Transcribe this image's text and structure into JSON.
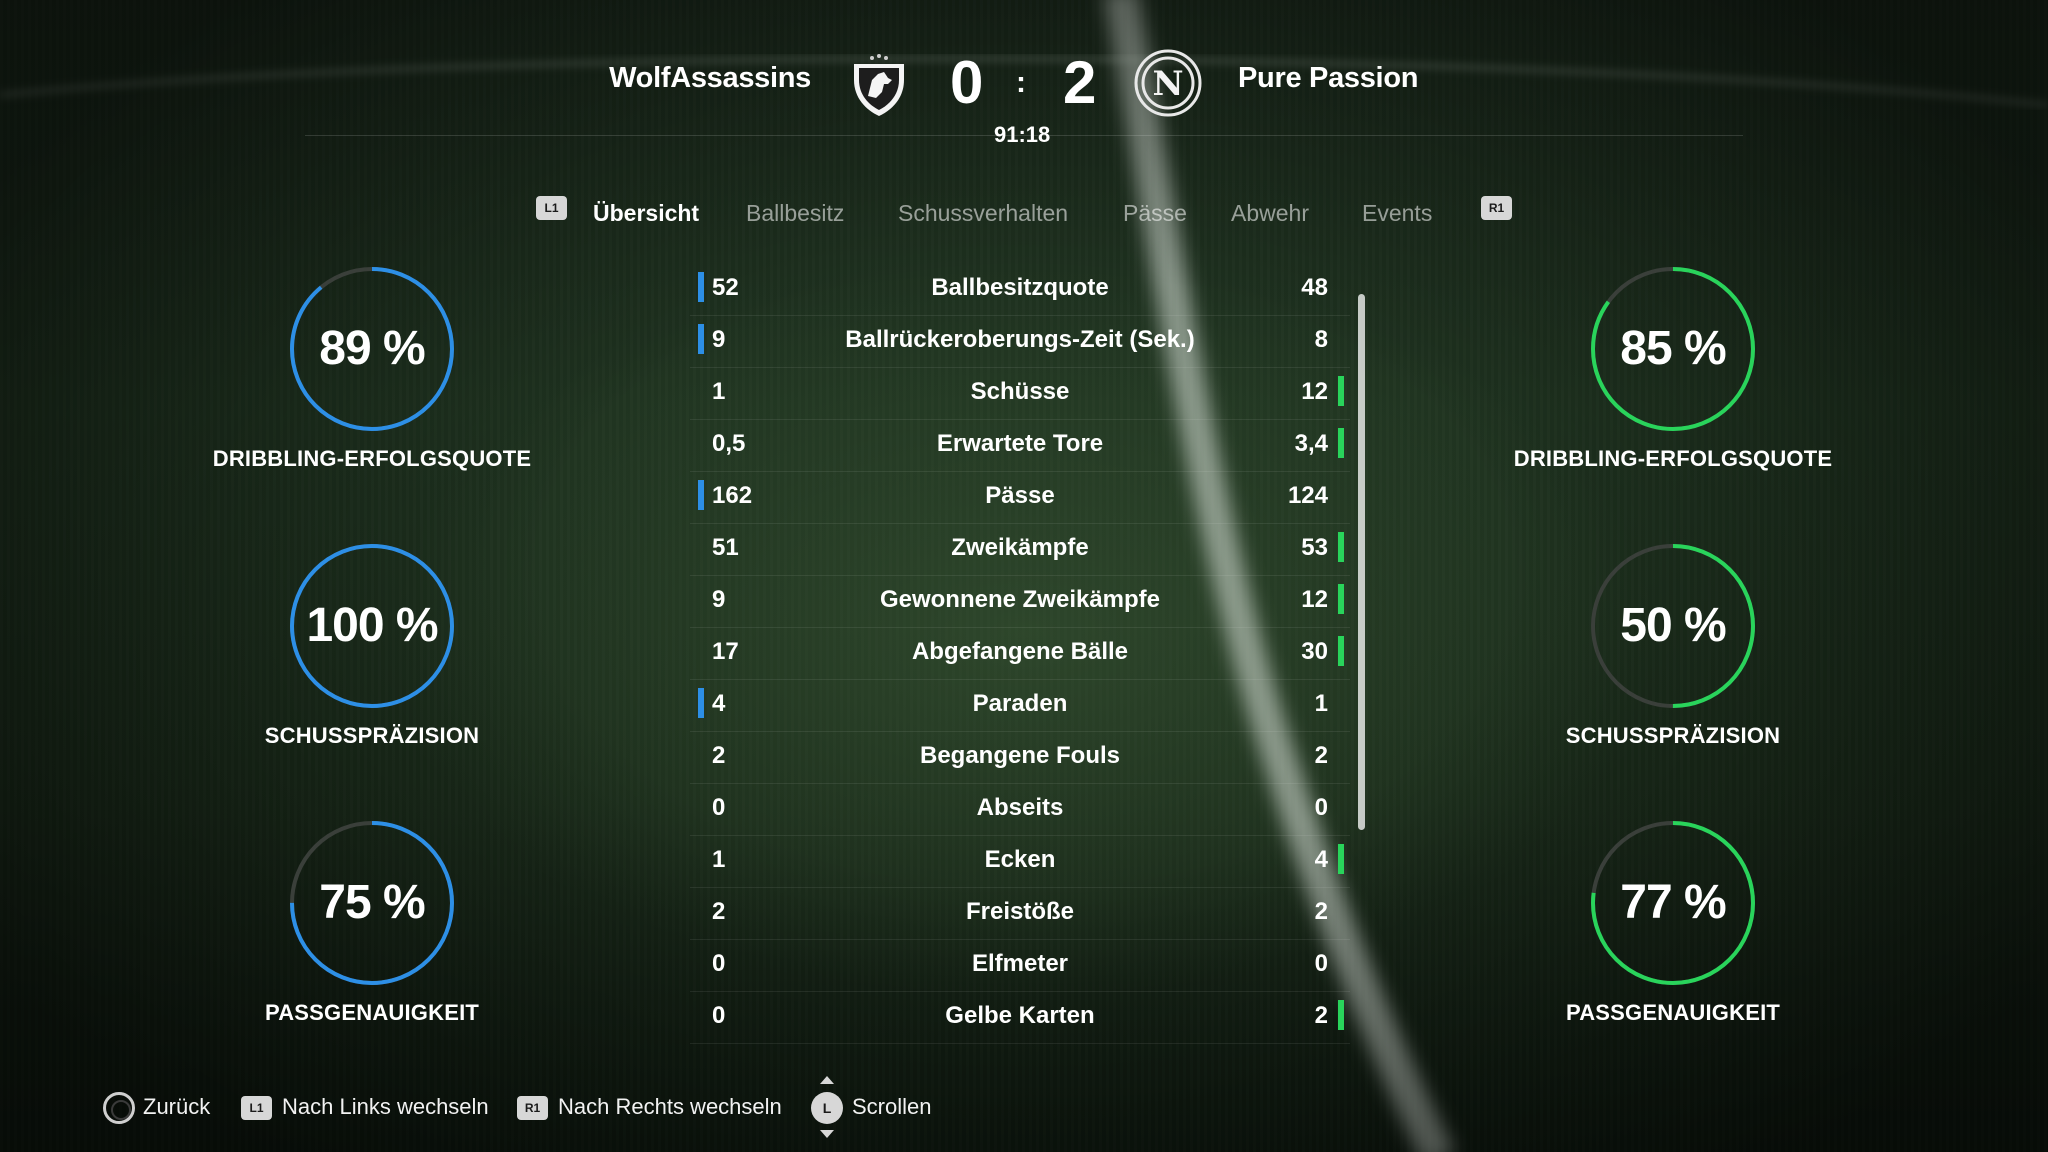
{
  "match": {
    "home_team": "WolfAssassins",
    "away_team": "Pure Passion",
    "home_score": "0",
    "away_score": "2",
    "separator": ":",
    "time": "91:18",
    "away_crest_letter": "N",
    "home_crest_icon": "wolf-shield-icon",
    "away_crest_icon": "napoli-crest-icon"
  },
  "tabs": {
    "prev_button": "L1",
    "next_button": "R1",
    "items": [
      {
        "label": "Übersicht",
        "active": true
      },
      {
        "label": "Ballbesitz",
        "active": false
      },
      {
        "label": "Schussverhalten",
        "active": false
      },
      {
        "label": "Pässe",
        "active": false
      },
      {
        "label": "Abwehr",
        "active": false
      },
      {
        "label": "Events",
        "active": false
      }
    ]
  },
  "home_gauges": [
    {
      "value": "89 %",
      "percent": 89,
      "label": "DRIBBLING-ERFOLGSQUOTE"
    },
    {
      "value": "100 %",
      "percent": 100,
      "label": "SCHUSSPRÄZISION"
    },
    {
      "value": "75 %",
      "percent": 75,
      "label": "PASSGENAUIGKEIT"
    }
  ],
  "away_gauges": [
    {
      "value": "85 %",
      "percent": 85,
      "label": "DRIBBLING-ERFOLGSQUOTE"
    },
    {
      "value": "50 %",
      "percent": 50,
      "label": "SCHUSSPRÄZISION"
    },
    {
      "value": "77 %",
      "percent": 77,
      "label": "PASSGENAUIGKEIT"
    }
  ],
  "colors": {
    "home_accent": "#2d8fe6",
    "away_accent": "#29d45b",
    "gauge_track": "#3a3f3a"
  },
  "stats": [
    {
      "name": "Ballbesitzquote",
      "home": "52",
      "away": "48",
      "leader": "home"
    },
    {
      "name": "Ballrückeroberungs-Zeit (Sek.)",
      "home": "9",
      "away": "8",
      "leader": "home"
    },
    {
      "name": "Schüsse",
      "home": "1",
      "away": "12",
      "leader": "away"
    },
    {
      "name": "Erwartete Tore",
      "home": "0,5",
      "away": "3,4",
      "leader": "away"
    },
    {
      "name": "Pässe",
      "home": "162",
      "away": "124",
      "leader": "home"
    },
    {
      "name": "Zweikämpfe",
      "home": "51",
      "away": "53",
      "leader": "away"
    },
    {
      "name": "Gewonnene Zweikämpfe",
      "home": "9",
      "away": "12",
      "leader": "away"
    },
    {
      "name": "Abgefangene Bälle",
      "home": "17",
      "away": "30",
      "leader": "away"
    },
    {
      "name": "Paraden",
      "home": "4",
      "away": "1",
      "leader": "home"
    },
    {
      "name": "Begangene Fouls",
      "home": "2",
      "away": "2",
      "leader": "none"
    },
    {
      "name": "Abseits",
      "home": "0",
      "away": "0",
      "leader": "none"
    },
    {
      "name": "Ecken",
      "home": "1",
      "away": "4",
      "leader": "away"
    },
    {
      "name": "Freistöße",
      "home": "2",
      "away": "2",
      "leader": "none"
    },
    {
      "name": "Elfmeter",
      "home": "0",
      "away": "0",
      "leader": "none"
    },
    {
      "name": "Gelbe Karten",
      "home": "0",
      "away": "2",
      "leader": "away"
    }
  ],
  "footer": {
    "back": "Zurück",
    "left_button": "L1",
    "left": "Nach Links wechseln",
    "right_button": "R1",
    "right": "Nach Rechts wechseln",
    "stick_button": "L",
    "scroll": "Scrollen"
  }
}
